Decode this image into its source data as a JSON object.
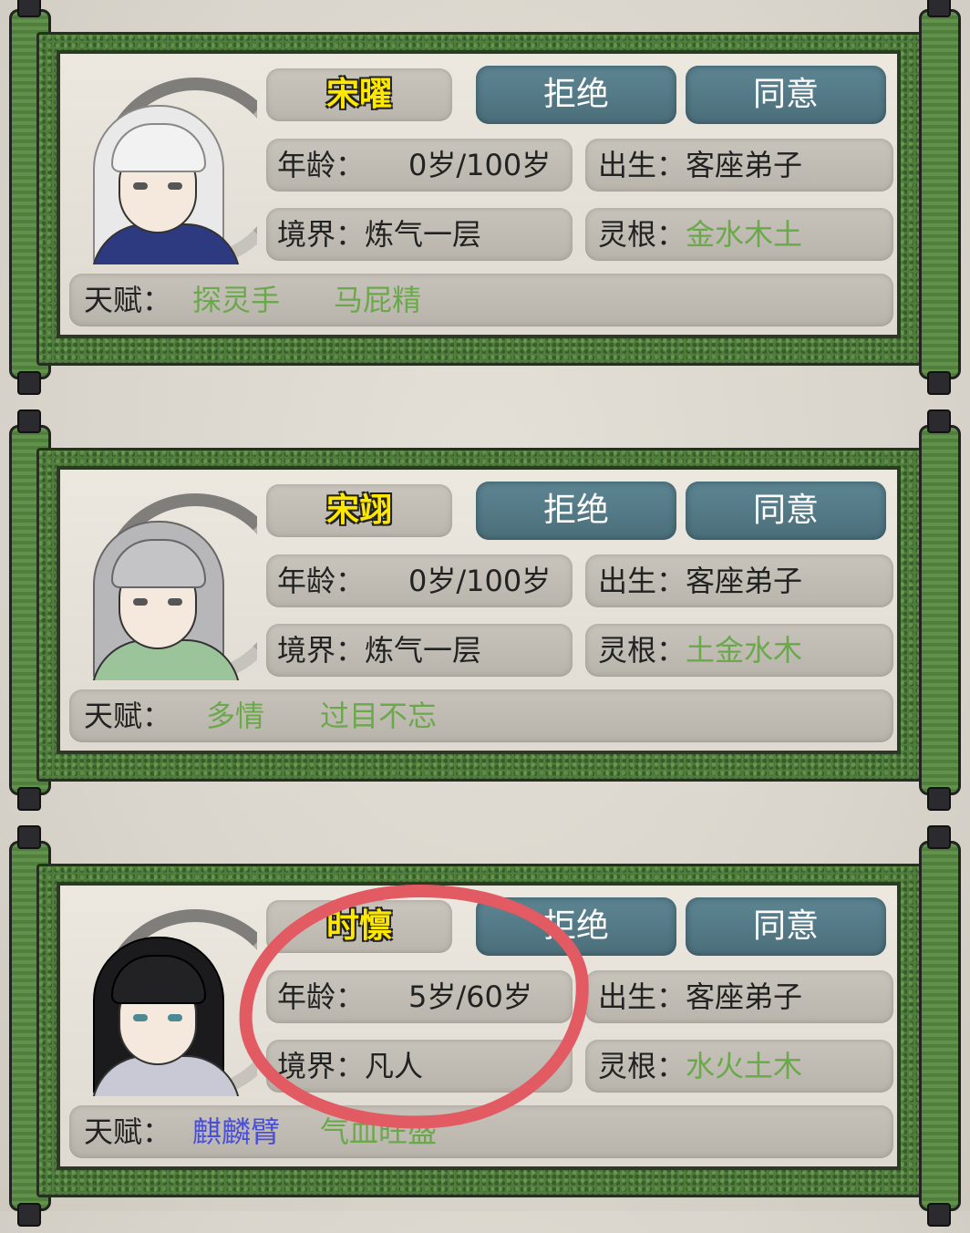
{
  "labels": {
    "age": "年龄：",
    "birth": "出生：",
    "realm": "境界：",
    "root": "灵根：",
    "talent": "天赋："
  },
  "buttons": {
    "reject": "拒绝",
    "agree": "同意"
  },
  "disciples": [
    {
      "name": "宋曜",
      "age": "0岁/100岁",
      "birth": "客座弟子",
      "realm": "炼气一层",
      "root": "金水木土",
      "talents": [
        "探灵手",
        "马屁精"
      ],
      "hair_color": "#e9e9ea",
      "robe_color": "#2d3a80"
    },
    {
      "name": "宋翊",
      "age": "0岁/100岁",
      "birth": "客座弟子",
      "realm": "炼气一层",
      "root": "土金水木",
      "talents": [
        "多情",
        "过目不忘"
      ],
      "hair_color": "#b7b7b9",
      "robe_color": "#9cc49a"
    },
    {
      "name": "时懔",
      "age": "5岁/60岁",
      "birth": "客座弟子",
      "realm": "凡人",
      "root": "水火土木",
      "talents": [
        "麒麟臂",
        "气血旺盛"
      ],
      "hair_color": "#1b1b1d",
      "robe_color": "#c9c9d6"
    }
  ],
  "colors": {
    "talent_green": "#6ba84b",
    "talent_blue": "#4a4fd8",
    "name_yellow": "#ffe800",
    "annotation_red": "#e25a62"
  }
}
